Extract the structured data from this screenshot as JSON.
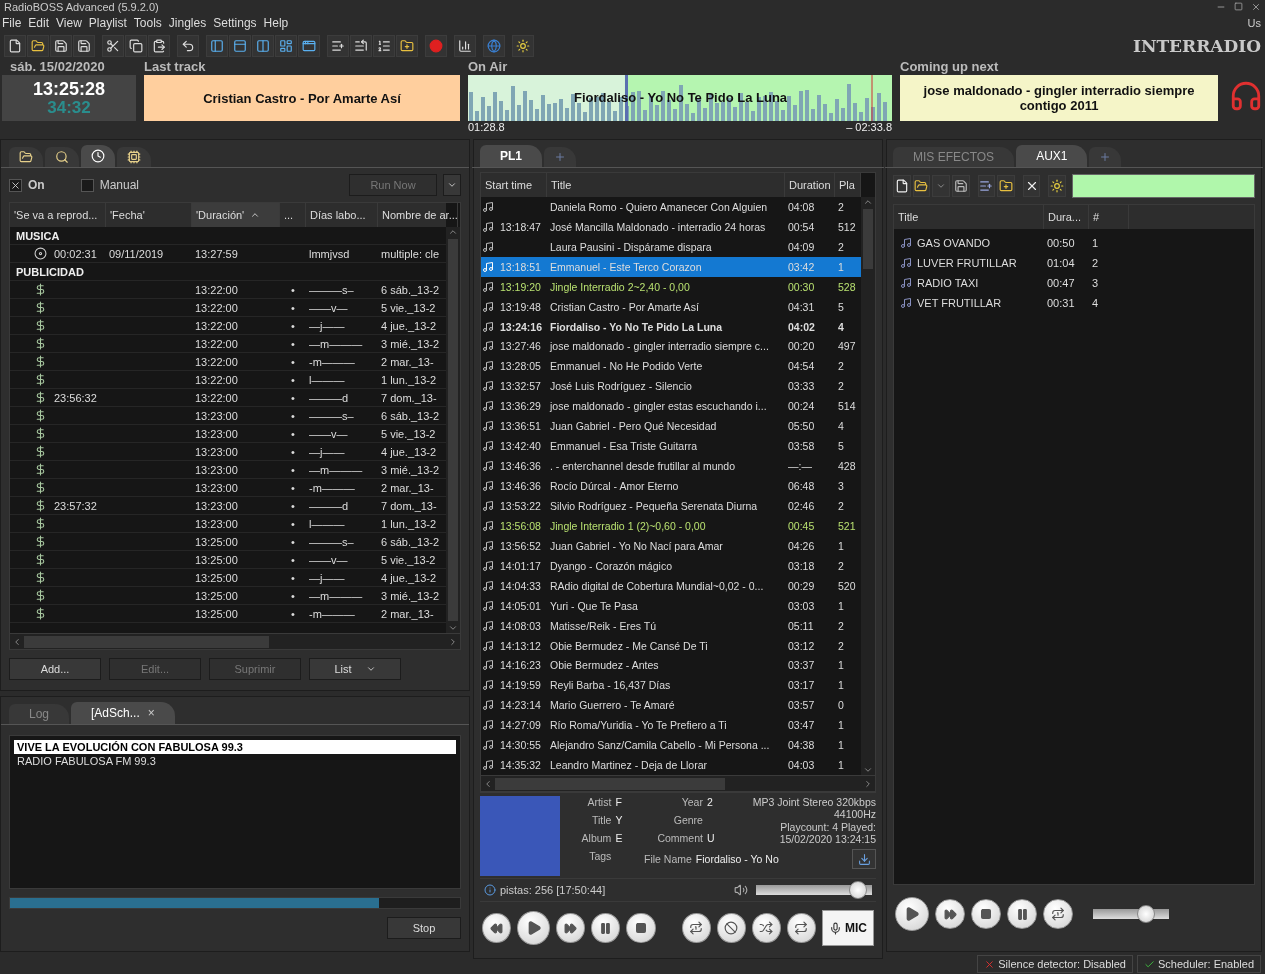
{
  "window": {
    "title": "RadioBOSS Advanced (5.9.2.0)",
    "user": "Us",
    "station": "INTERRADIO"
  },
  "menu": [
    "File",
    "Edit",
    "View",
    "Playlist",
    "Tools",
    "Jingles",
    "Settings",
    "Help"
  ],
  "clock": {
    "date": "sáb. 15/02/2020",
    "time": "13:25:28",
    "remaining": "34:32"
  },
  "last_track": {
    "label": "Last track",
    "title": "Cristian Castro - Por Amarte Así"
  },
  "on_air": {
    "label": "On Air",
    "title": "Fiordaliso - Yo No Te Pido La Luna",
    "elapsed": "01:28.8",
    "remaining": "– 02:33.8",
    "level": 0.37
  },
  "coming_up": {
    "label": "Coming up next",
    "title": "jose maldonado - gingler interradio siempre contigo 2011"
  },
  "scheduler": {
    "tabs": [
      {
        "selected": false
      },
      {
        "selected": false
      },
      {
        "selected": true
      },
      {
        "selected": false
      }
    ],
    "on": {
      "label": "On",
      "checked": true
    },
    "manual": {
      "label": "Manual",
      "checked": false
    },
    "run_now": {
      "label": "Run Now",
      "disabled": true
    },
    "columns": [
      {
        "label": "'Se va a reprod...",
        "sorted": false
      },
      {
        "label": "'Fecha'",
        "sorted": false
      },
      {
        "label": "'Duración'",
        "sorted": true
      },
      {
        "label": "...",
        "sorted": false
      },
      {
        "label": "Días labo...",
        "sorted": false
      },
      {
        "label": "Nombre de ar...",
        "sorted": false
      }
    ],
    "groups": [
      {
        "name": "MUSICA",
        "rows": [
          {
            "kind": "music",
            "time": "00:02:31",
            "date": "09/11/2019",
            "start": "13:27:59",
            "days": "lmmjvsd",
            "name": "multiple: cle"
          }
        ]
      },
      {
        "name": "PUBLICIDAD",
        "rows": [
          {
            "kind": "ad",
            "start": "13:22:00",
            "mark": "•",
            "days": "———s–",
            "name": "6 sáb._13-2"
          },
          {
            "kind": "ad",
            "start": "13:22:00",
            "mark": "•",
            "days": "——v—",
            "name": "5 vie._13-2"
          },
          {
            "kind": "ad",
            "start": "13:22:00",
            "mark": "•",
            "days": "—j——",
            "name": "4 jue._13-2"
          },
          {
            "kind": "ad",
            "start": "13:22:00",
            "mark": "•",
            "days": "—m———",
            "name": "3 mié._13-2"
          },
          {
            "kind": "ad",
            "start": "13:22:00",
            "mark": "•",
            "days": "-m———",
            "name": "2 mar._13-"
          },
          {
            "kind": "ad",
            "start": "13:22:00",
            "mark": "•",
            "days": "l———",
            "name": "1 lun._13-2"
          },
          {
            "kind": "ad",
            "time": "23:56:32",
            "start": "13:22:00",
            "mark": "•",
            "days": "———d",
            "name": "7 dom._13-"
          },
          {
            "kind": "ad",
            "start": "13:23:00",
            "mark": "•",
            "days": "———s–",
            "name": "6 sáb._13-2"
          },
          {
            "kind": "ad",
            "start": "13:23:00",
            "mark": "•",
            "days": "——v—",
            "name": "5 vie._13-2"
          },
          {
            "kind": "ad",
            "start": "13:23:00",
            "mark": "•",
            "days": "—j——",
            "name": "4 jue._13-2"
          },
          {
            "kind": "ad",
            "start": "13:23:00",
            "mark": "•",
            "days": "—m———",
            "name": "3 mié._13-2"
          },
          {
            "kind": "ad",
            "start": "13:23:00",
            "mark": "•",
            "days": "-m———",
            "name": "2 mar._13-"
          },
          {
            "kind": "ad",
            "time": "23:57:32",
            "start": "13:23:00",
            "mark": "•",
            "days": "———d",
            "name": "7 dom._13-"
          },
          {
            "kind": "ad",
            "start": "13:23:00",
            "mark": "•",
            "days": "l———",
            "name": "1 lun._13-2"
          },
          {
            "kind": "ad",
            "start": "13:25:00",
            "mark": "•",
            "days": "———s–",
            "name": "6 sáb._13-2"
          },
          {
            "kind": "ad",
            "start": "13:25:00",
            "mark": "•",
            "days": "——v—",
            "name": "5 vie._13-2"
          },
          {
            "kind": "ad",
            "start": "13:25:00",
            "mark": "•",
            "days": "—j——",
            "name": "4 jue._13-2"
          },
          {
            "kind": "ad",
            "start": "13:25:00",
            "mark": "•",
            "days": "—m———",
            "name": "3 mié._13-2"
          },
          {
            "kind": "ad",
            "start": "13:25:00",
            "mark": "•",
            "days": "-m———",
            "name": "2 mar._13-"
          }
        ]
      }
    ],
    "buttons": [
      {
        "label": "Add...",
        "disabled": false,
        "menu": false
      },
      {
        "label": "Edit...",
        "disabled": true,
        "menu": false
      },
      {
        "label": "Suprimir",
        "disabled": true,
        "menu": false
      },
      {
        "label": "List",
        "disabled": false,
        "menu": true
      }
    ]
  },
  "log": {
    "tabs": [
      {
        "label": "Log",
        "selected": false
      },
      {
        "label": "[AdSch...",
        "selected": true,
        "close": "×"
      }
    ],
    "lines": [
      {
        "text": "VIVE LA EVOLUCIÓN CON FABULOSA 99.3",
        "selected": true
      },
      {
        "text": "RADIO FABULOSA FM 99.3",
        "selected": false
      }
    ],
    "level": 0.82,
    "stop": "Stop"
  },
  "playlist": {
    "tabs": [
      {
        "label": "PL1",
        "selected": true
      }
    ],
    "columns": [
      "Start time",
      "Title",
      "Duration",
      "Pla"
    ],
    "rows": [
      {
        "kind": "track",
        "title": "Daniela Romo - Quiero Amanecer Con Alguien",
        "duration": "04:08",
        "plays": "2",
        "selected": false,
        "playing": false
      },
      {
        "kind": "track",
        "start": "13:18:47",
        "title": "José  Mancilla Maldonado - interradio 24 horas",
        "duration": "00:54",
        "plays": "512",
        "selected": false,
        "playing": false
      },
      {
        "kind": "track",
        "title": "Laura Pausini - Dispárame dispara",
        "duration": "04:09",
        "plays": "2",
        "selected": false,
        "playing": false
      },
      {
        "kind": "track",
        "start": "13:18:51",
        "title": "Emmanuel - Este Terco Corazon",
        "duration": "03:42",
        "plays": "1",
        "selected": true,
        "playing": false
      },
      {
        "kind": "jingle",
        "start": "13:19:20",
        "title": "Jingle Interradio 2~2,40 - 0,00",
        "duration": "00:30",
        "plays": "528",
        "selected": false,
        "playing": false
      },
      {
        "kind": "track",
        "start": "13:19:48",
        "title": "Cristian Castro - Por Amarte Así",
        "duration": "04:31",
        "plays": "5",
        "selected": false,
        "playing": false
      },
      {
        "kind": "track",
        "start": "13:24:16",
        "title": "Fiordaliso - Yo No Te Pido La Luna",
        "duration": "04:02",
        "plays": "4",
        "selected": false,
        "playing": true
      },
      {
        "kind": "track",
        "start": "13:27:46",
        "title": "jose maldonado - gingler interradio siempre c...",
        "duration": "00:20",
        "plays": "497",
        "selected": false,
        "playing": false
      },
      {
        "kind": "track",
        "start": "13:28:05",
        "title": "Emmanuel - No He Podido Verte",
        "duration": "04:54",
        "plays": "2",
        "selected": false,
        "playing": false
      },
      {
        "kind": "track",
        "start": "13:32:57",
        "title": "José Luis Rodríguez - Silencio",
        "duration": "03:33",
        "plays": "2",
        "selected": false,
        "playing": false
      },
      {
        "kind": "track",
        "start": "13:36:29",
        "title": "jose maldonado - gingler estas escuchando i...",
        "duration": "00:24",
        "plays": "514",
        "selected": false,
        "playing": false
      },
      {
        "kind": "track",
        "start": "13:36:51",
        "title": "Juan Gabriel - Pero Qué Necesidad",
        "duration": "05:50",
        "plays": "4",
        "selected": false,
        "playing": false
      },
      {
        "kind": "track",
        "start": "13:42:40",
        "title": "Emmanuel - Esa Triste Guitarra",
        "duration": "03:58",
        "plays": "5",
        "selected": false,
        "playing": false
      },
      {
        "kind": "track",
        "start": "13:46:36",
        "title": ". - enterchannel desde frutillar al mundo",
        "duration": "—:—",
        "plays": "428",
        "selected": false,
        "playing": false
      },
      {
        "kind": "track",
        "start": "13:46:36",
        "title": "Rocío Dúrcal - Amor Eterno",
        "duration": "06:48",
        "plays": "3",
        "selected": false,
        "playing": false
      },
      {
        "kind": "track",
        "start": "13:53:22",
        "title": "Silvio Rodríguez - Pequeña Serenata Diurna",
        "duration": "02:46",
        "plays": "2",
        "selected": false,
        "playing": false
      },
      {
        "kind": "jingle",
        "start": "13:56:08",
        "title": "Jingle Interradio 1 (2)~0,60 - 0,00",
        "duration": "00:45",
        "plays": "521",
        "selected": false,
        "playing": false
      },
      {
        "kind": "track",
        "start": "13:56:52",
        "title": "Juan Gabriel - Yo No Nací para Amar",
        "duration": "04:26",
        "plays": "1",
        "selected": false,
        "playing": false
      },
      {
        "kind": "track",
        "start": "14:01:17",
        "title": "Dyango - Corazón mágico",
        "duration": "03:18",
        "plays": "2",
        "selected": false,
        "playing": false
      },
      {
        "kind": "track",
        "start": "14:04:33",
        "title": "RAdio digital de Cobertura Mundial~0,02 - 0...",
        "duration": "00:29",
        "plays": "520",
        "selected": false,
        "playing": false
      },
      {
        "kind": "track",
        "start": "14:05:01",
        "title": "Yuri - Que Te Pasa",
        "duration": "03:03",
        "plays": "1",
        "selected": false,
        "playing": false
      },
      {
        "kind": "track",
        "start": "14:08:03",
        "title": "Matisse/Reik - Eres Tú",
        "duration": "05:11",
        "plays": "2",
        "selected": false,
        "playing": false
      },
      {
        "kind": "track",
        "start": "14:13:12",
        "title": "Obie Bermudez - Me Cansé De Ti",
        "duration": "03:12",
        "plays": "2",
        "selected": false,
        "playing": false
      },
      {
        "kind": "track",
        "start": "14:16:23",
        "title": "Obie Bermudez - Antes",
        "duration": "03:37",
        "plays": "1",
        "selected": false,
        "playing": false
      },
      {
        "kind": "track",
        "start": "14:19:59",
        "title": "Reyli Barba - 16,437 Días",
        "duration": "03:17",
        "plays": "1",
        "selected": false,
        "playing": false
      },
      {
        "kind": "track",
        "start": "14:23:14",
        "title": "Mario Guerrero - Te Amaré",
        "duration": "03:57",
        "plays": "0",
        "selected": false,
        "playing": false
      },
      {
        "kind": "track",
        "start": "14:27:09",
        "title": "Río Roma/Yuridia - Yo Te Prefiero a Ti",
        "duration": "03:47",
        "plays": "1",
        "selected": false,
        "playing": false
      },
      {
        "kind": "track",
        "start": "14:30:55",
        "title": "Alejandro Sanz/Camila Cabello - Mi Persona ...",
        "duration": "04:38",
        "plays": "1",
        "selected": false,
        "playing": false
      },
      {
        "kind": "track",
        "start": "14:35:32",
        "title": "Leandro Martinez - Deja de Llorar",
        "duration": "04:03",
        "plays": "1",
        "selected": false,
        "playing": false
      }
    ]
  },
  "track_info": {
    "fields": [
      {
        "label": "Artist",
        "value": "F"
      },
      {
        "label": "Title",
        "value": "Y"
      },
      {
        "label": "Album",
        "value": "E"
      },
      {
        "label": "Tags"
      }
    ],
    "fields2": [
      {
        "label": "Year",
        "value": "2"
      },
      {
        "label": "Genre"
      },
      {
        "label": "Comment",
        "value": "U"
      },
      {
        "label": "File Name",
        "value": "Fiordaliso - Yo No"
      }
    ],
    "format": "MP3 Joint Stereo 320kbps 44100Hz",
    "playcount": "Playcount: 4 Played: 15/02/2020 13:24:15"
  },
  "tracks_status": "pistas: 256 [17:50:44]",
  "volume": {
    "level": 0.95
  },
  "mic": "MIC",
  "aux": {
    "tabs": [
      {
        "label": "MIS EFECTOS",
        "selected": false
      },
      {
        "label": "AUX1",
        "selected": true
      }
    ],
    "columns": [
      "Title",
      "Dura...",
      "#"
    ],
    "rows": [
      {
        "title": "GAS OVANDO",
        "duration": "00:50",
        "number": "1"
      },
      {
        "title": "LUVER FRUTILLAR",
        "duration": "01:04",
        "number": "2"
      },
      {
        "title": "RADIO TAXI",
        "duration": "00:47",
        "number": "3"
      },
      {
        "title": "VET FRUTILLAR",
        "duration": "00:31",
        "number": "4"
      }
    ],
    "volume": {
      "level": 0.75
    }
  },
  "status_bar": [
    {
      "text": "Silence detector: Disabled",
      "kind": "error"
    },
    {
      "text": "Scheduler: Enabled",
      "kind": "ok"
    }
  ]
}
